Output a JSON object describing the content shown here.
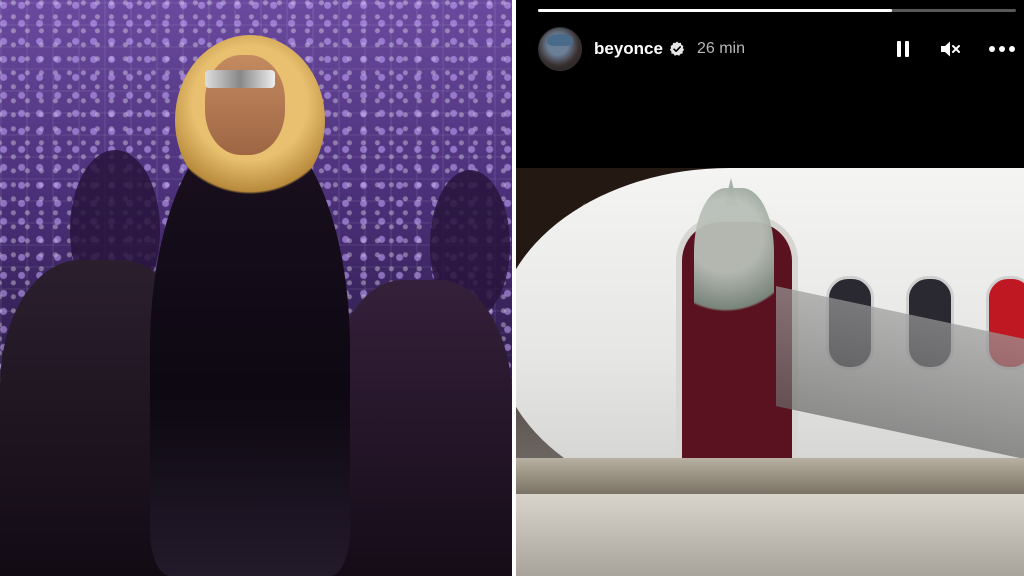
{
  "left_photo": {
    "alt": "performer-photo"
  },
  "story": {
    "progress": 0.74,
    "account": {
      "username": "beyonce",
      "verified": true,
      "time_ago": "26 min"
    },
    "controls": {
      "pause_icon": "pause-icon",
      "mute_icon": "mute-icon",
      "more_icon": "more-options-icon"
    },
    "media_alt": "story-image"
  },
  "colors": {
    "background": "#000000",
    "text": "#ffffff",
    "time_text": "#b8b8b8",
    "progress_track": "rgba(255,255,255,0.35)"
  }
}
